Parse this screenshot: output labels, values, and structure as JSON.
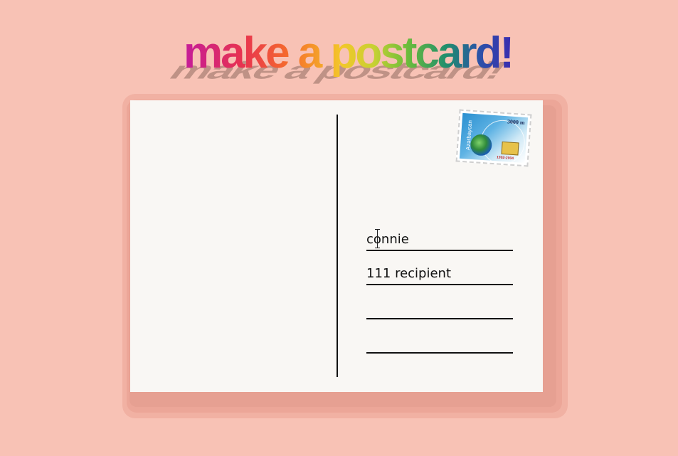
{
  "header": {
    "title": "make a postcard!"
  },
  "stamp": {
    "value": "3000 m",
    "country": "Azərbaycan",
    "years": "1992-2004"
  },
  "address": {
    "line1": "connie",
    "line2": "111 recipient",
    "line3": "",
    "line4": ""
  },
  "colors": {
    "background": "#f8c2b5",
    "card": "#f9f7f4"
  }
}
